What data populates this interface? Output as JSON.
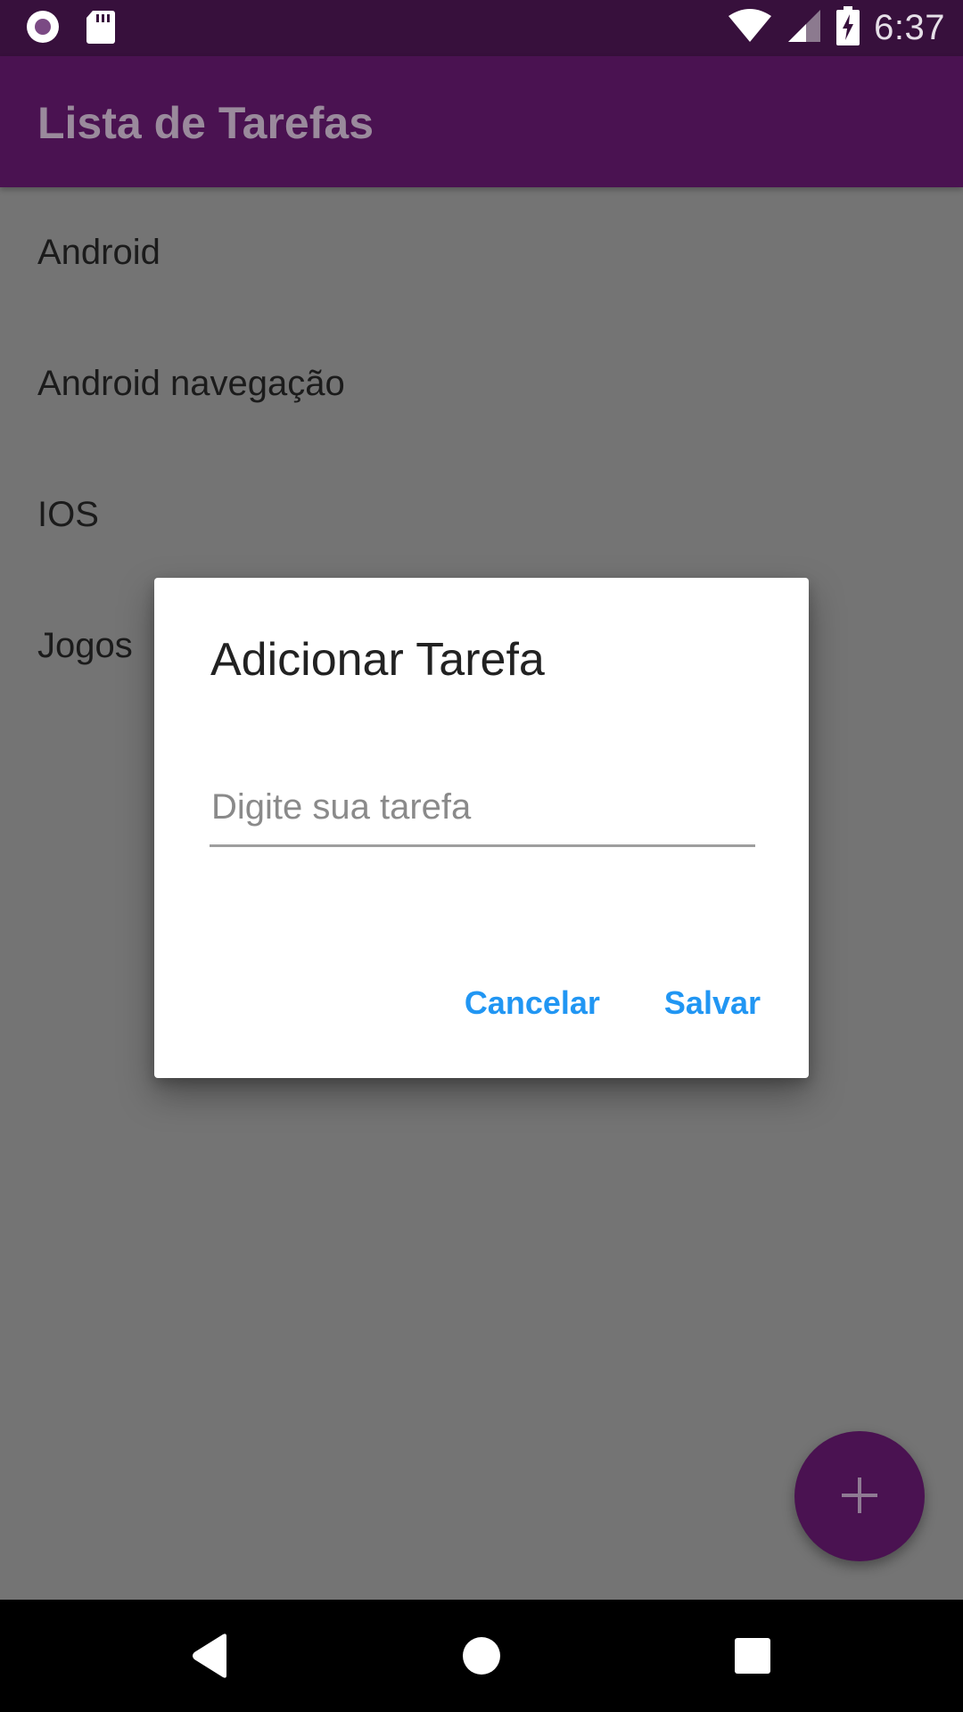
{
  "status_bar": {
    "time": "6:37",
    "icons": [
      "record-icon",
      "sd-card-icon",
      "wifi-icon",
      "signal-icon",
      "battery-charging-icon"
    ]
  },
  "app_bar": {
    "title": "Lista de Tarefas"
  },
  "task_list": {
    "items": [
      {
        "label": "Android"
      },
      {
        "label": "Android navegação"
      },
      {
        "label": "IOS"
      },
      {
        "label": "Jogos"
      }
    ]
  },
  "dialog": {
    "title": "Adicionar Tarefa",
    "input": {
      "value": "",
      "placeholder": "Digite sua tarefa"
    },
    "cancel_label": "Cancelar",
    "save_label": "Salvar",
    "button_color": "#2196f3"
  },
  "fab": {
    "icon": "plus-icon",
    "color": "#4a1251"
  },
  "nav_bar": {
    "icons": [
      "back-icon",
      "home-icon",
      "recents-icon"
    ]
  },
  "colors": {
    "primary": "#4a1251",
    "primary_dark": "#37103c",
    "accent": "#2196f3",
    "scrim_background": "#747474"
  }
}
